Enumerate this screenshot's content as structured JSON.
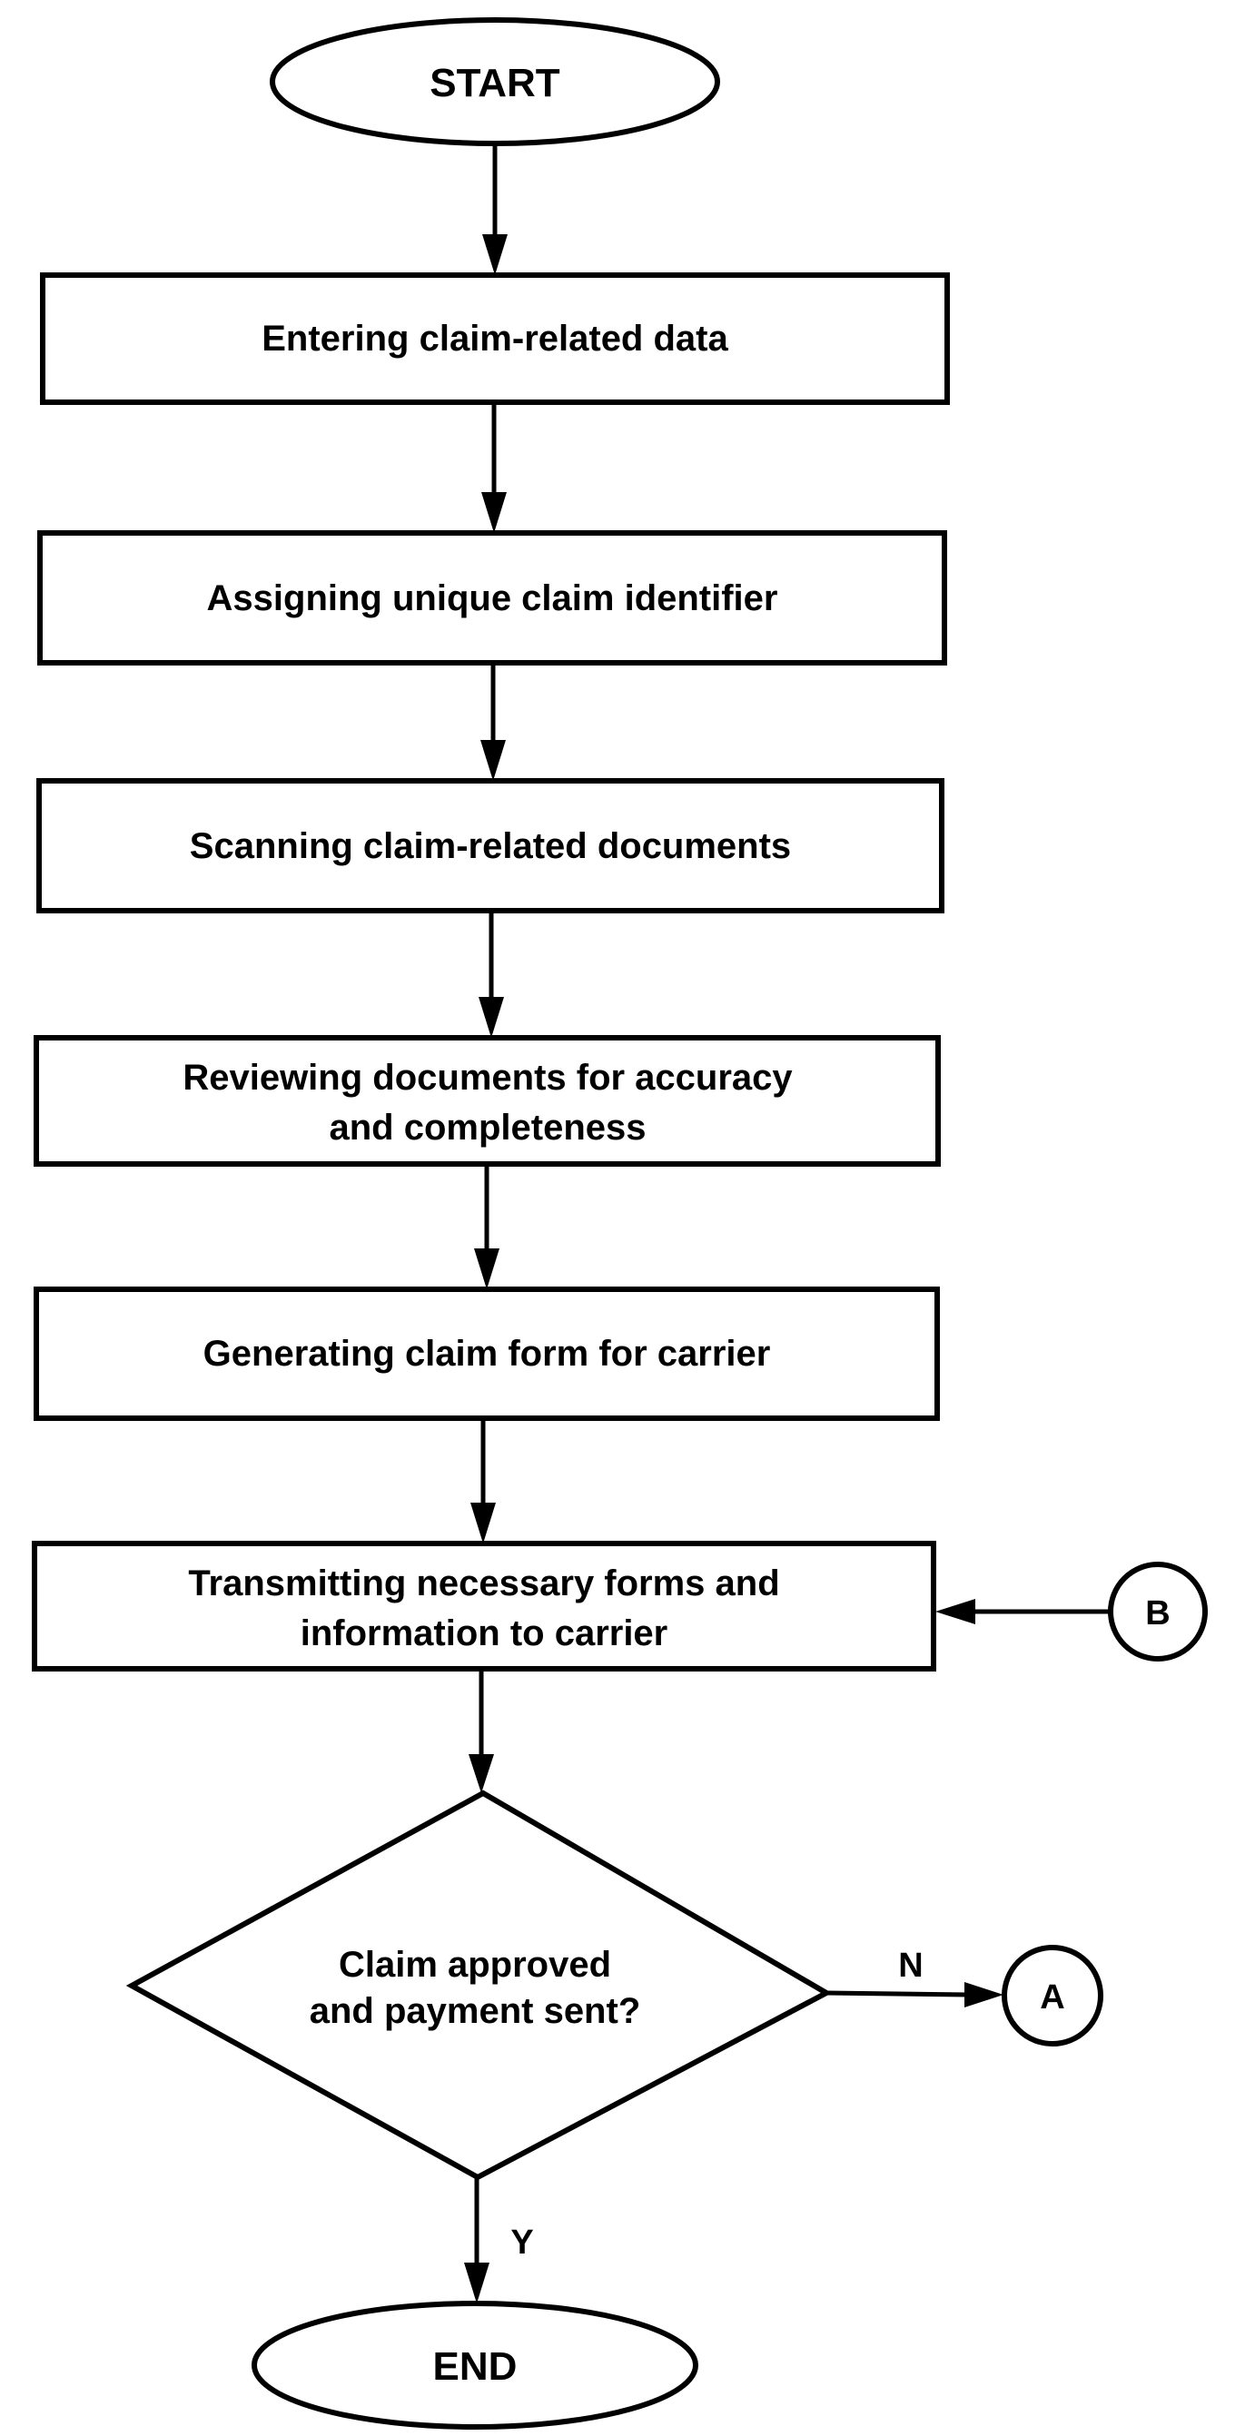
{
  "flowchart": {
    "start": {
      "label": "START"
    },
    "end": {
      "label": "END"
    },
    "steps": [
      {
        "lines": [
          "Entering claim-related data"
        ]
      },
      {
        "lines": [
          "Assigning unique claim identifier"
        ]
      },
      {
        "lines": [
          "Scanning claim-related documents"
        ]
      },
      {
        "lines": [
          "Reviewing documents for accuracy",
          "and completeness"
        ]
      },
      {
        "lines": [
          "Generating claim form for carrier"
        ]
      },
      {
        "lines": [
          "Transmitting necessary forms and",
          "information to carrier"
        ]
      }
    ],
    "decision": {
      "lines": [
        "Claim approved",
        "and payment sent?"
      ],
      "yes_label": "Y",
      "no_label": "N"
    },
    "connectors": {
      "a": {
        "label": "A"
      },
      "b": {
        "label": "B"
      }
    },
    "colors": {
      "ink": "#000000",
      "paper": "#ffffff"
    }
  }
}
